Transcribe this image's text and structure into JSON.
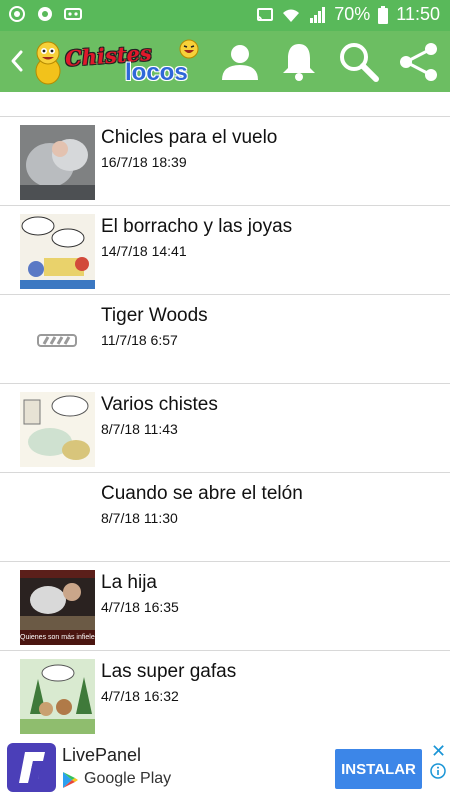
{
  "status_bar": {
    "battery": "70%",
    "time": "11:50"
  },
  "app_bar": {
    "logo_word1": "Chistes",
    "logo_word2": "locos"
  },
  "list": [
    {
      "title": "Chicles para el vuelo",
      "date": "16/7/18 18:39",
      "thumb": "photo"
    },
    {
      "title": "El borracho y las joyas",
      "date": "14/7/18 14:41",
      "thumb": "comic"
    },
    {
      "title": "Tiger Woods",
      "date": "11/7/18 6:57",
      "thumb": "loading"
    },
    {
      "title": "Varios chistes",
      "date": "8/7/18 11:43",
      "thumb": "comic2"
    },
    {
      "title": "Cuando se abre el telón",
      "date": "8/7/18 11:30",
      "thumb": "none"
    },
    {
      "title": "La hija",
      "date": "4/7/18 16:35",
      "thumb": "dark"
    },
    {
      "title": "Las super gafas",
      "date": "4/7/18 16:32",
      "thumb": "cartoon"
    }
  ],
  "thumb_captions": {
    "la_hija": "Quienes son más infieles"
  },
  "ad": {
    "app_name": "LivePanel",
    "store": "Google Play",
    "button": "INSTALAR",
    "close": "✕"
  },
  "colors": {
    "status_bar": "#59b95a",
    "app_bar": "#6cbe62",
    "install_button": "#3c86e8",
    "ad_icon": "#4b3fb8"
  }
}
